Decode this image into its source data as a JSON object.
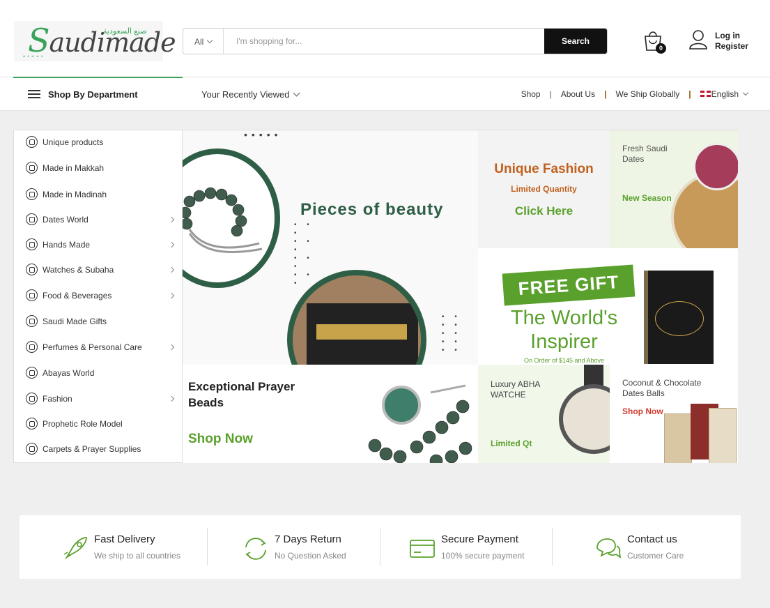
{
  "logo": {
    "brand": "Saudimade",
    "arabic": "صنع السعودية"
  },
  "search": {
    "category": "All",
    "placeholder": "I'm shopping for...",
    "button": "Search"
  },
  "cart": {
    "count": "0"
  },
  "account": {
    "login": "Log in",
    "register": "Register"
  },
  "nav": {
    "department": "Shop By Department",
    "recent": "Your Recently Viewed",
    "links": [
      "Shop",
      "About Us",
      "We Ship Globally"
    ],
    "language": "English"
  },
  "sidebar": {
    "items": [
      {
        "label": "Unique products",
        "has_sub": false
      },
      {
        "label": "Made in Makkah",
        "has_sub": false
      },
      {
        "label": "Made in Madinah",
        "has_sub": false
      },
      {
        "label": "Dates World",
        "has_sub": true
      },
      {
        "label": "Hands Made",
        "has_sub": true
      },
      {
        "label": "Watches & Subaha",
        "has_sub": true
      },
      {
        "label": "Food & Beverages",
        "has_sub": true
      },
      {
        "label": "Saudi Made Gifts",
        "has_sub": false
      },
      {
        "label": "Perfumes & Personal Care",
        "has_sub": true
      },
      {
        "label": "Abayas World",
        "has_sub": false
      },
      {
        "label": "Fashion",
        "has_sub": true
      },
      {
        "label": "Prophetic Role Model",
        "has_sub": false
      },
      {
        "label": "Carpets & Prayer Supplies",
        "has_sub": false
      }
    ]
  },
  "banners": {
    "hero": {
      "title": "Pieces of beauty"
    },
    "fashion": {
      "title": "Unique Fashion",
      "subtitle": "Limited Quantity",
      "cta": "Click Here"
    },
    "dates": {
      "title": "Fresh Saudi Dates",
      "subtitle": "New Season"
    },
    "gift": {
      "tag": "FREE GIFT",
      "line1": "The World's",
      "line2": "Inspirer",
      "note": "On Order of $145 and Above"
    },
    "prayer": {
      "title": "Exceptional Prayer Beads",
      "cta": "Shop Now"
    },
    "watch": {
      "title": "Luxury ABHA WATCHE",
      "subtitle": "Limited Qt"
    },
    "balls": {
      "title": "Coconut & Chocolate Dates Balls",
      "subtitle": "Shop Now"
    }
  },
  "features": [
    {
      "icon": "rocket-icon",
      "title": "Fast Delivery",
      "subtitle": "We ship to all countries"
    },
    {
      "icon": "return-icon",
      "title": "7 Days Return",
      "subtitle": "No Question Asked"
    },
    {
      "icon": "credit-card-icon",
      "title": "Secure Payment",
      "subtitle": "100% secure payment"
    },
    {
      "icon": "chat-icon",
      "title": "Contact us",
      "subtitle": "Customer Care"
    }
  ],
  "colors": {
    "accent_green": "#5aa02c",
    "dark_green": "#2e5e45",
    "orange": "#c0611d",
    "red": "#d13b2f"
  }
}
